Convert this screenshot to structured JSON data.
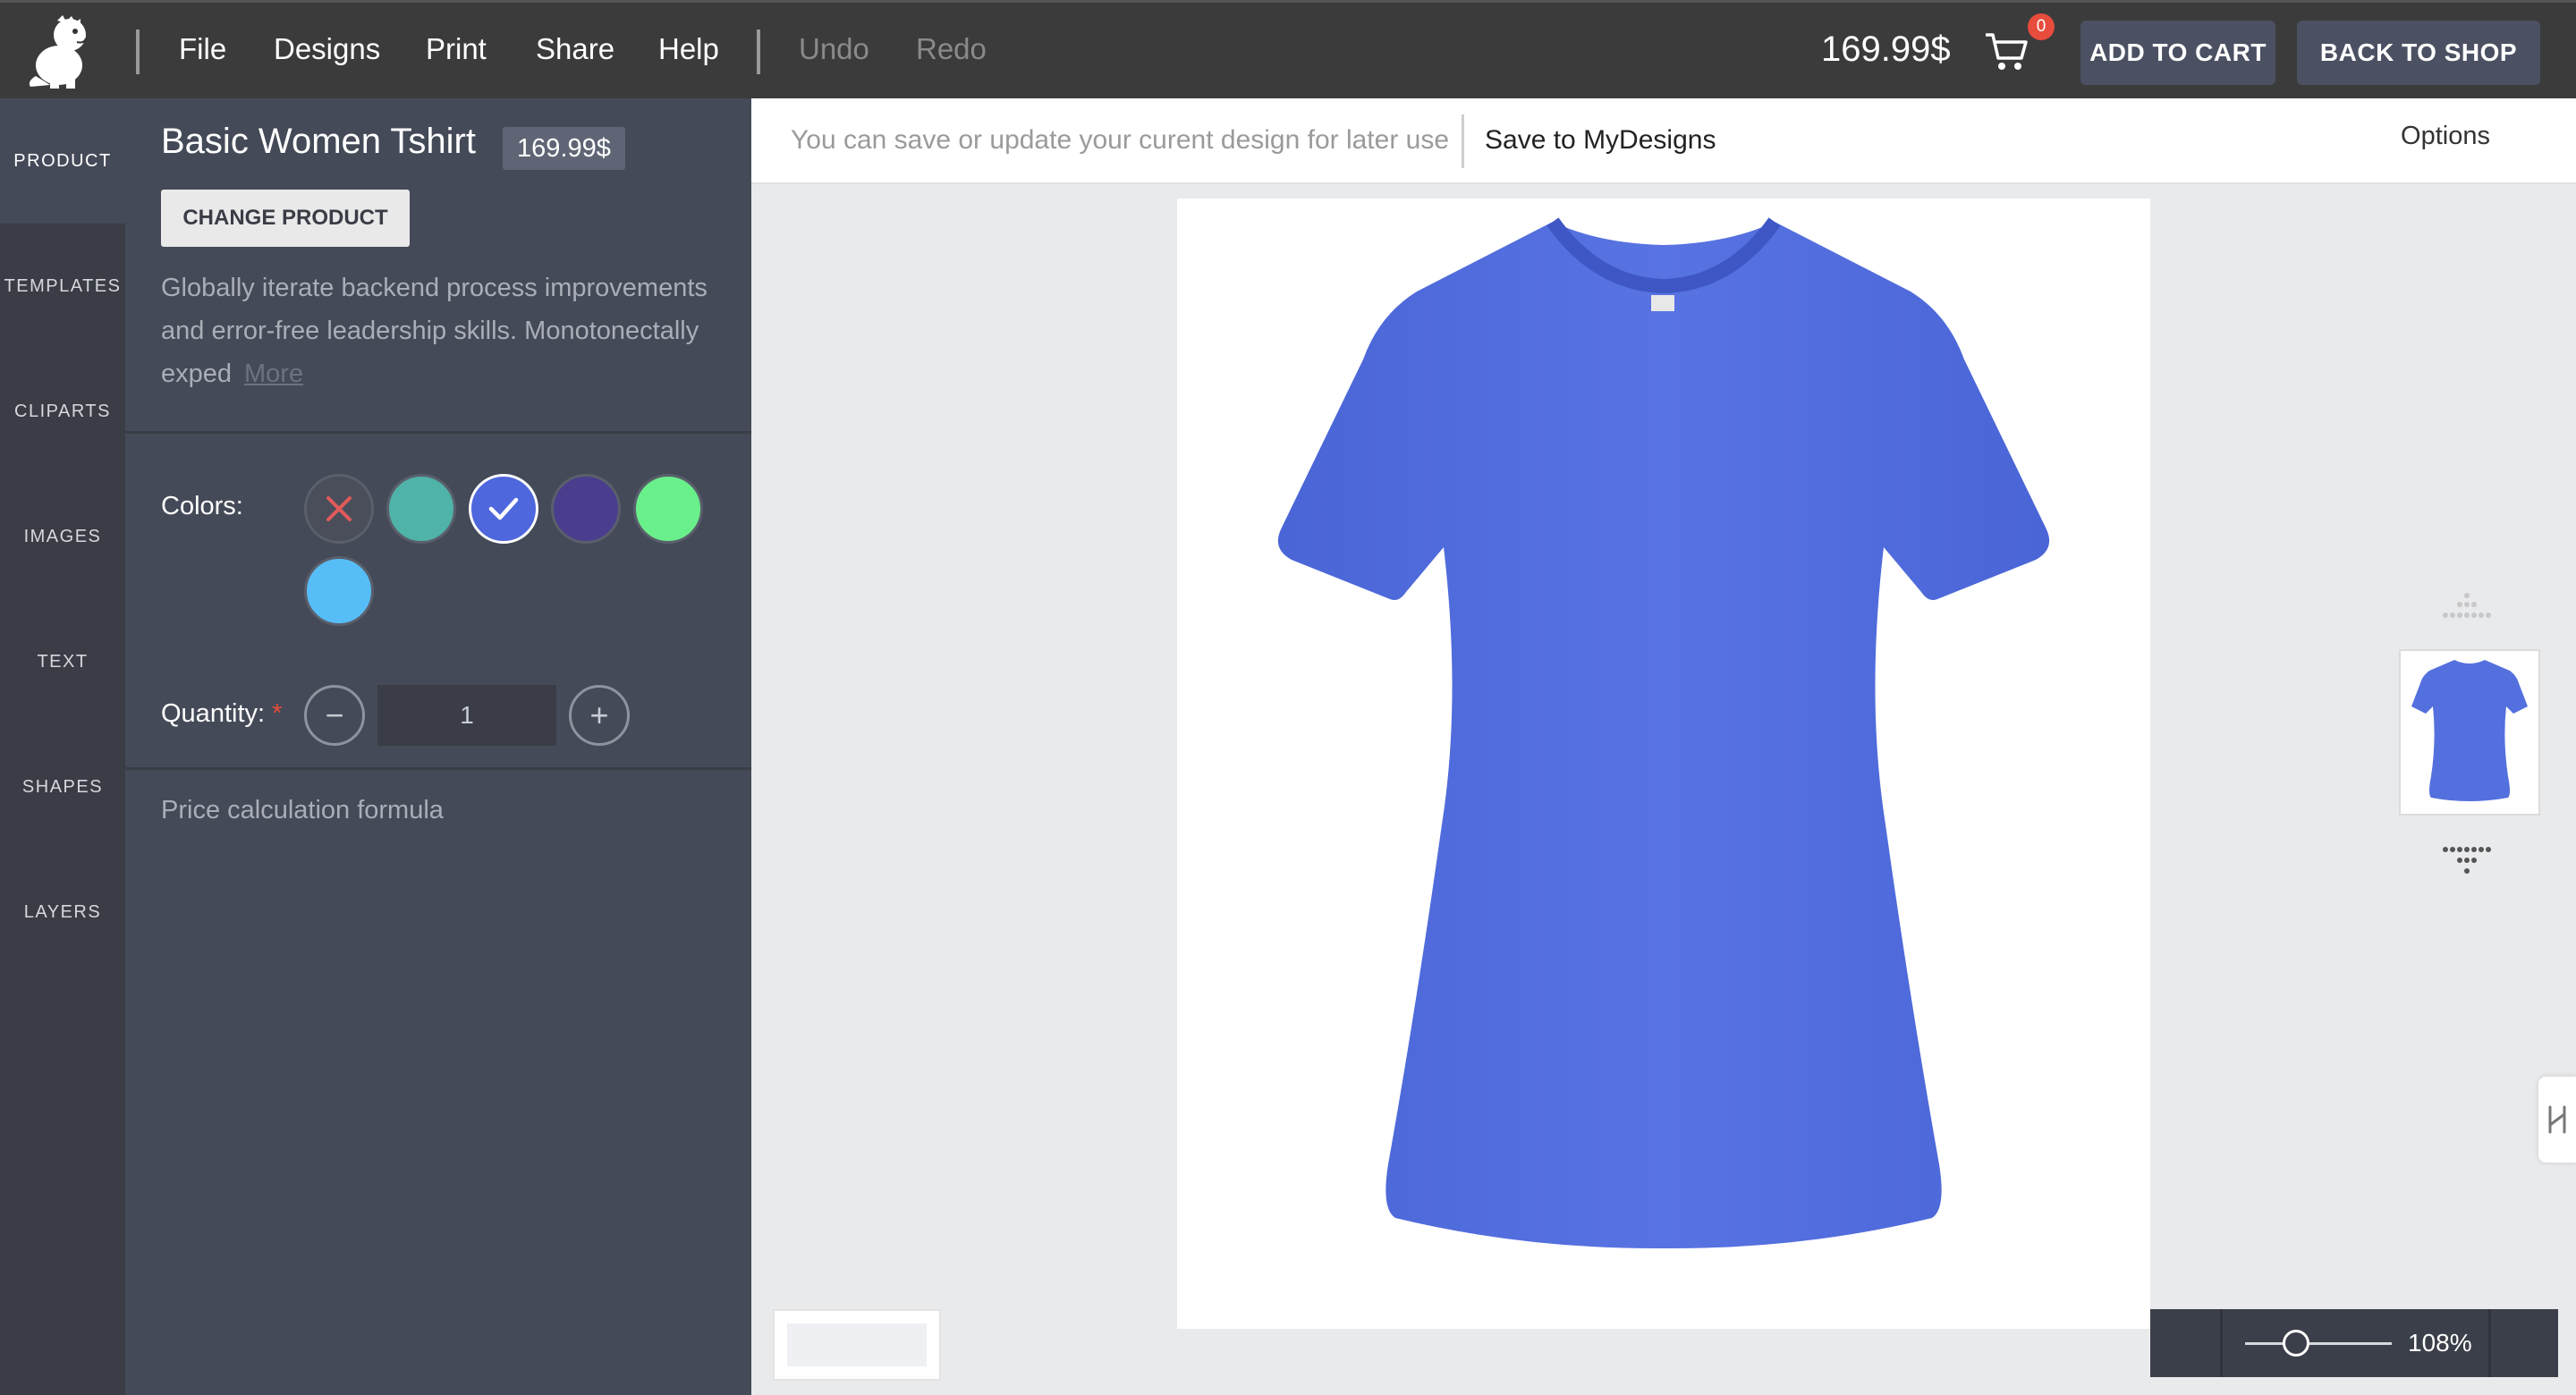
{
  "topbar": {
    "menu": [
      "File",
      "Designs",
      "Print",
      "Share",
      "Help"
    ],
    "undo": "Undo",
    "redo": "Redo",
    "price": "169.99$",
    "cart_count": "0",
    "add_to_cart": "ADD TO CART",
    "back_to_shop": "BACK TO SHOP"
  },
  "rail": {
    "tabs": [
      "PRODUCT",
      "TEMPLATES",
      "CLIPARTS",
      "IMAGES",
      "TEXT",
      "SHAPES",
      "LAYERS"
    ]
  },
  "panel": {
    "title": "Basic Women Tshirt",
    "price": "169.99$",
    "change_product": "CHANGE PRODUCT",
    "description": "Globally iterate backend process improvements and error-free leadership skills. Monotonectally exped",
    "more": "More",
    "colors_label": "Colors:",
    "colors": [
      {
        "hex": "#4a4e5a",
        "icon": "none-x-icon",
        "selected": false
      },
      {
        "hex": "#4fb3a9",
        "selected": false
      },
      {
        "hex": "#4f67dc",
        "icon": "check-icon",
        "selected": true
      },
      {
        "hex": "#4a3d8e",
        "selected": false
      },
      {
        "hex": "#6af08b",
        "selected": false
      },
      {
        "hex": "#57bdf6",
        "selected": false
      }
    ],
    "quantity_label": "Quantity:",
    "quantity_required": "*",
    "quantity_value": "1",
    "minus": "−",
    "plus": "+",
    "formula": "Price calculation formula"
  },
  "savebar": {
    "hint": "You can save or update your curent design for later use",
    "save_button": "Save to MyDesigns",
    "options": "Options"
  },
  "stage": {
    "shirt_color": "#5470de"
  },
  "zoom": {
    "value": "108%",
    "level": 0.35
  }
}
